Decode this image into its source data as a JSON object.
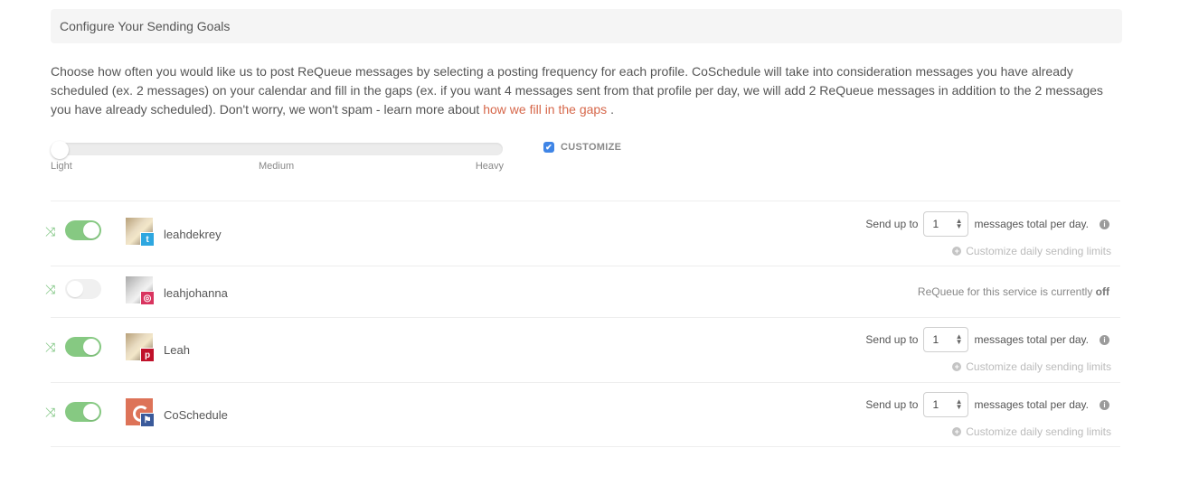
{
  "header": {
    "title": "Configure Your Sending Goals"
  },
  "intro": {
    "text": "Choose how often you would like us to post ReQueue messages by selecting a posting frequency for each profile. CoSchedule will take into consideration messages you have already scheduled (ex. 2 messages) on your calendar and fill in the gaps (ex. if you want 4 messages sent from that profile per day, we will add 2 ReQueue messages in addition to the 2 messages you have already scheduled). Don't worry, we won't spam - learn more about ",
    "link_label": "how we fill in the gaps",
    "suffix": " ."
  },
  "frequency_slider": {
    "value": "Light",
    "position_fraction": 0,
    "labels": {
      "light": "Light",
      "medium": "Medium",
      "heavy": "Heavy"
    }
  },
  "customize": {
    "label": "CUSTOMIZE",
    "checked": true,
    "accent": "#3f85e6"
  },
  "send_labels": {
    "prefix": "Send up to",
    "suffix": "messages total per day.",
    "customize_limits": "Customize daily sending limits",
    "off_prefix": "ReQueue for this service is currently",
    "off_word": "off"
  },
  "profiles": [
    {
      "name": "leahdekrey",
      "network": "twitter",
      "enabled": true,
      "messages_per_day": "1"
    },
    {
      "name": "leahjohanna",
      "network": "instagram",
      "enabled": false
    },
    {
      "name": "Leah",
      "network": "pinterest",
      "enabled": true,
      "messages_per_day": "1"
    },
    {
      "name": "CoSchedule",
      "network": "facebook",
      "enabled": true,
      "messages_per_day": "1"
    }
  ],
  "colors": {
    "link": "#d6674a",
    "toggle_on": "#86c982",
    "shuffle_icon": "#7cc47f"
  }
}
